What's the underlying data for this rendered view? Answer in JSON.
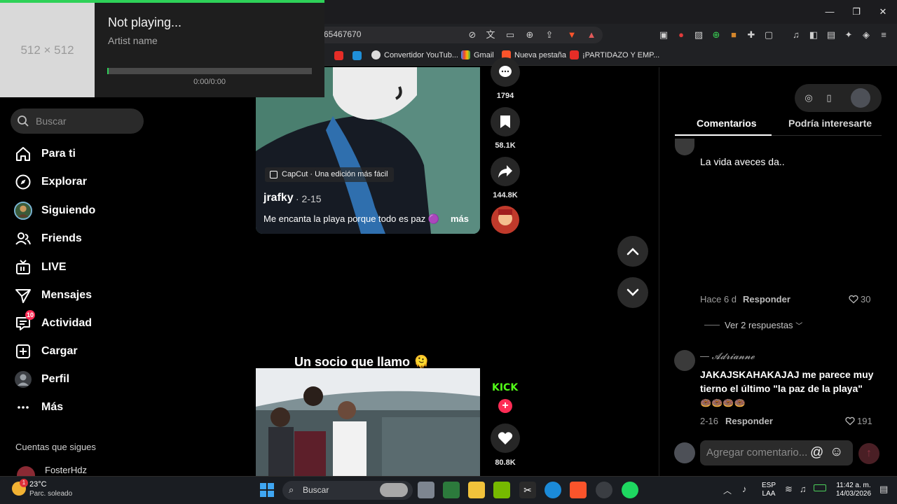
{
  "media": {
    "art_placeholder": "512 × 512",
    "title": "Not playing...",
    "artist": "Artist name",
    "time": "0:00/0:00",
    "progress": 0
  },
  "browser": {
    "url": "65467670",
    "bookmarks": [
      {
        "label": "Convertidor YouTub...",
        "icon": "youtube-icon"
      },
      {
        "label": "Gmail",
        "icon": "gmail-icon"
      },
      {
        "label": "Nueva pestaña",
        "icon": "brave-icon"
      },
      {
        "label": "¡PARTIDAZO Y EMP...",
        "icon": "youtube-icon"
      }
    ],
    "window_controls": {
      "minimize": "—",
      "maximize": "❐",
      "close": "✕"
    }
  },
  "sidebar": {
    "search_placeholder": "Buscar",
    "items": [
      {
        "label": "Para ti",
        "icon": "home-icon"
      },
      {
        "label": "Explorar",
        "icon": "compass-icon"
      },
      {
        "label": "Siguiendo",
        "icon": "following-avatar-icon"
      },
      {
        "label": "Friends",
        "icon": "friends-icon"
      },
      {
        "label": "LIVE",
        "icon": "live-tv-icon"
      },
      {
        "label": "Mensajes",
        "icon": "send-icon"
      },
      {
        "label": "Actividad",
        "icon": "inbox-icon",
        "badge": "10"
      },
      {
        "label": "Cargar",
        "icon": "upload-plus-icon"
      },
      {
        "label": "Perfil",
        "icon": "profile-avatar-icon"
      },
      {
        "label": "Más",
        "icon": "more-dots-icon"
      }
    ],
    "following_title": "Cuentas que sigues",
    "following": [
      {
        "name": "FosterHdz"
      }
    ]
  },
  "video1": {
    "capcut": "CapCut · Una edición más fácil",
    "author": "jrafky",
    "date": "· 2-15",
    "caption": "Me encanta la playa porque todo es paz 🟣",
    "more": "más",
    "actions": {
      "comments": "1794",
      "saves": "58.1K",
      "shares": "144.8K"
    }
  },
  "video2": {
    "title": "Un socio que llamo 🫠",
    "likes": "80.8K",
    "kick_label": "KICK"
  },
  "comments_panel": {
    "tabs": [
      "Comentarios",
      "Podría interesarte"
    ],
    "comment1": {
      "text": "La vida aveces da..",
      "time": "Hace 6 d",
      "reply": "Responder",
      "likes": "30",
      "view_replies": "Ver 2 respuestas"
    },
    "comment2": {
      "author": "— 𝓐𝓭𝓻𝓲𝓪𝓷𝓷𝓮",
      "text_line1": "JAKAJSKAHAKAJAJ me parece muy",
      "text_line2": "tierno el último \"la paz de la playa\"",
      "emojis": "🍩🍩🍩🍩",
      "time": "2-16",
      "reply": "Responder",
      "likes": "191"
    },
    "input_placeholder": "Agregar comentario..."
  },
  "taskbar": {
    "weather_temp": "23°C",
    "weather_desc": "Parc. soleado",
    "weather_badge": "1",
    "search": "Buscar",
    "lang_line1": "ESP",
    "lang_line2": "LAA",
    "time": "11:42 a. m.",
    "date": "14/03/2026"
  },
  "colors": {
    "accent_red": "#fe2c55",
    "media_green": "#2ed158",
    "background": "#000000"
  }
}
